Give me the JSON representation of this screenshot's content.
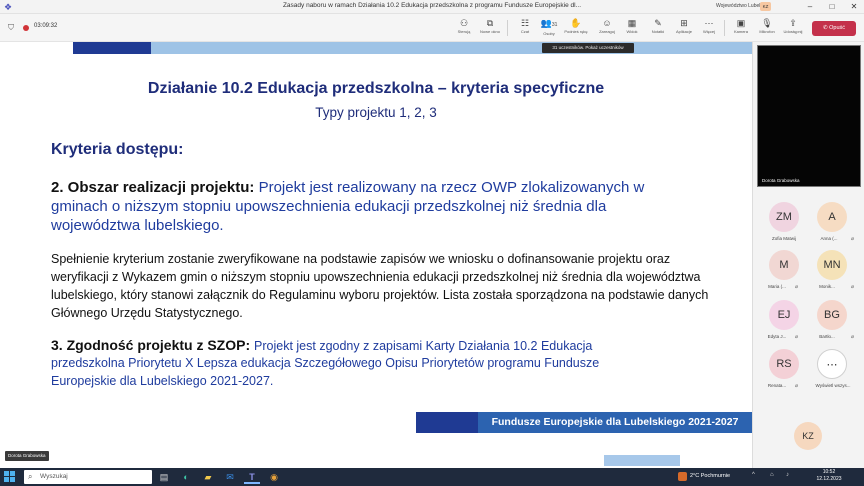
{
  "window": {
    "title": "Zasady naboru w ramach Działania 10.2 Edukacja przedszkolna z programu Fundusze Europejskie dl...",
    "account": "Województwo Lubelskie",
    "account_badge": "KZ",
    "minimize": "–",
    "maximize": "□",
    "close": "✕"
  },
  "meeting": {
    "elapsed": "03:09:32",
    "tools": [
      {
        "icon": "⚇",
        "label": "Sterują"
      },
      {
        "icon": "⧉",
        "label": "Nowe okno"
      },
      {
        "icon": "☷",
        "label": "Czat"
      },
      {
        "icon": "👥",
        "label": "Osoby",
        "count": "31"
      },
      {
        "icon": "✋",
        "label": "Podnieś rękę"
      },
      {
        "icon": "☺",
        "label": "Zareaguj"
      },
      {
        "icon": "▦",
        "label": "Widok"
      },
      {
        "icon": "✎",
        "label": "Notatki"
      },
      {
        "icon": "⊞",
        "label": "Aplikacje"
      },
      {
        "icon": "⋯",
        "label": "Więcej"
      },
      {
        "icon": "▣",
        "label": "Kamera"
      },
      {
        "icon": "🎙",
        "label": "Mikrofon"
      },
      {
        "icon": "⇪",
        "label": "Udostępnij"
      }
    ],
    "leave_label": "Opuść",
    "tooltip": "31 uczestników. Pokaż uczestników"
  },
  "slide": {
    "heading": "Działanie 10.2 Edukacja przedszkolna – kryteria specyficzne",
    "subheading": "Typy projektu 1, 2, 3",
    "section_title": "Kryteria dostępu:",
    "item2_title": "2. Obszar realizacji projektu:",
    "item2_l1": "Projekt jest realizowany na rzecz OWP zlokalizowanych w",
    "item2_l2": "gminach o niższym stopniu upowszechnienia edukacji przedszkolnej niż średnia dla",
    "item2_l3": "województwa lubelskiego.",
    "item2_body": "Spełnienie kryterium zostanie zweryfikowane na podstawie zapisów we wniosku o dofinansowanie projektu oraz weryfikacji z Wykazem gmin o niższym stopniu upowszechnienia edukacji przedszkolnej niż średnia dla województwa lubelskiego, który stanowi załącznik do Regulaminu wyboru projektów. Lista została sporządzona na podstawie danych Głównego Urzędu Statystycznego.",
    "item3_title": "3. Zgodność projektu z SZOP:",
    "item3_l1": "Projekt jest zgodny z zapisami Karty Działania 10.2 Edukacja",
    "item3_l2": "przedszkolna Priorytetu X Lepsza edukacja Szczegółowego Opisu Priorytetów programu Fundusze",
    "item3_l3": "Europejskie dla Lubelskiego 2021-2027.",
    "footer": "Fundusze Europejskie dla Lubelskiego 2021-2027"
  },
  "presenter_label": "Dorota Grabowska",
  "panel": {
    "video_label": "Dorota Grabowska",
    "participants": [
      {
        "initials": "ZM",
        "name": "Zofia Matwij",
        "color": "#f0d4e0"
      },
      {
        "initials": "A",
        "name": "Anna (...",
        "color": "#f6dcc3"
      },
      {
        "initials": "M",
        "name": "Maria (...",
        "color": "#f1d7d3"
      },
      {
        "initials": "MN",
        "name": "Monik...",
        "color": "#f5e2b8"
      },
      {
        "initials": "EJ",
        "name": "Edyta J...",
        "color": "#f4d4e6"
      },
      {
        "initials": "BG",
        "name": "Bartło...",
        "color": "#f5d6cc"
      },
      {
        "initials": "RS",
        "name": "Renata...",
        "color": "#f3d0d6"
      },
      {
        "initials": "⋯",
        "name": "Wyświetl wszys...",
        "color": "#ffffff"
      }
    ],
    "self_initials": "KZ",
    "self_color": "#f6d8bf"
  },
  "taskbar": {
    "search_placeholder": "Wyszukaj",
    "apps": [
      {
        "icon": "▤"
      },
      {
        "icon": "◐"
      },
      {
        "icon": "▰"
      },
      {
        "icon": "✉"
      },
      {
        "icon": "T"
      },
      {
        "icon": "◉"
      }
    ],
    "weather": "2°C Pochmurnie",
    "tray_up": "^",
    "tray_net": "⌂",
    "tray_vol": "♪",
    "time": "10:52",
    "date": "12.12.2023"
  }
}
